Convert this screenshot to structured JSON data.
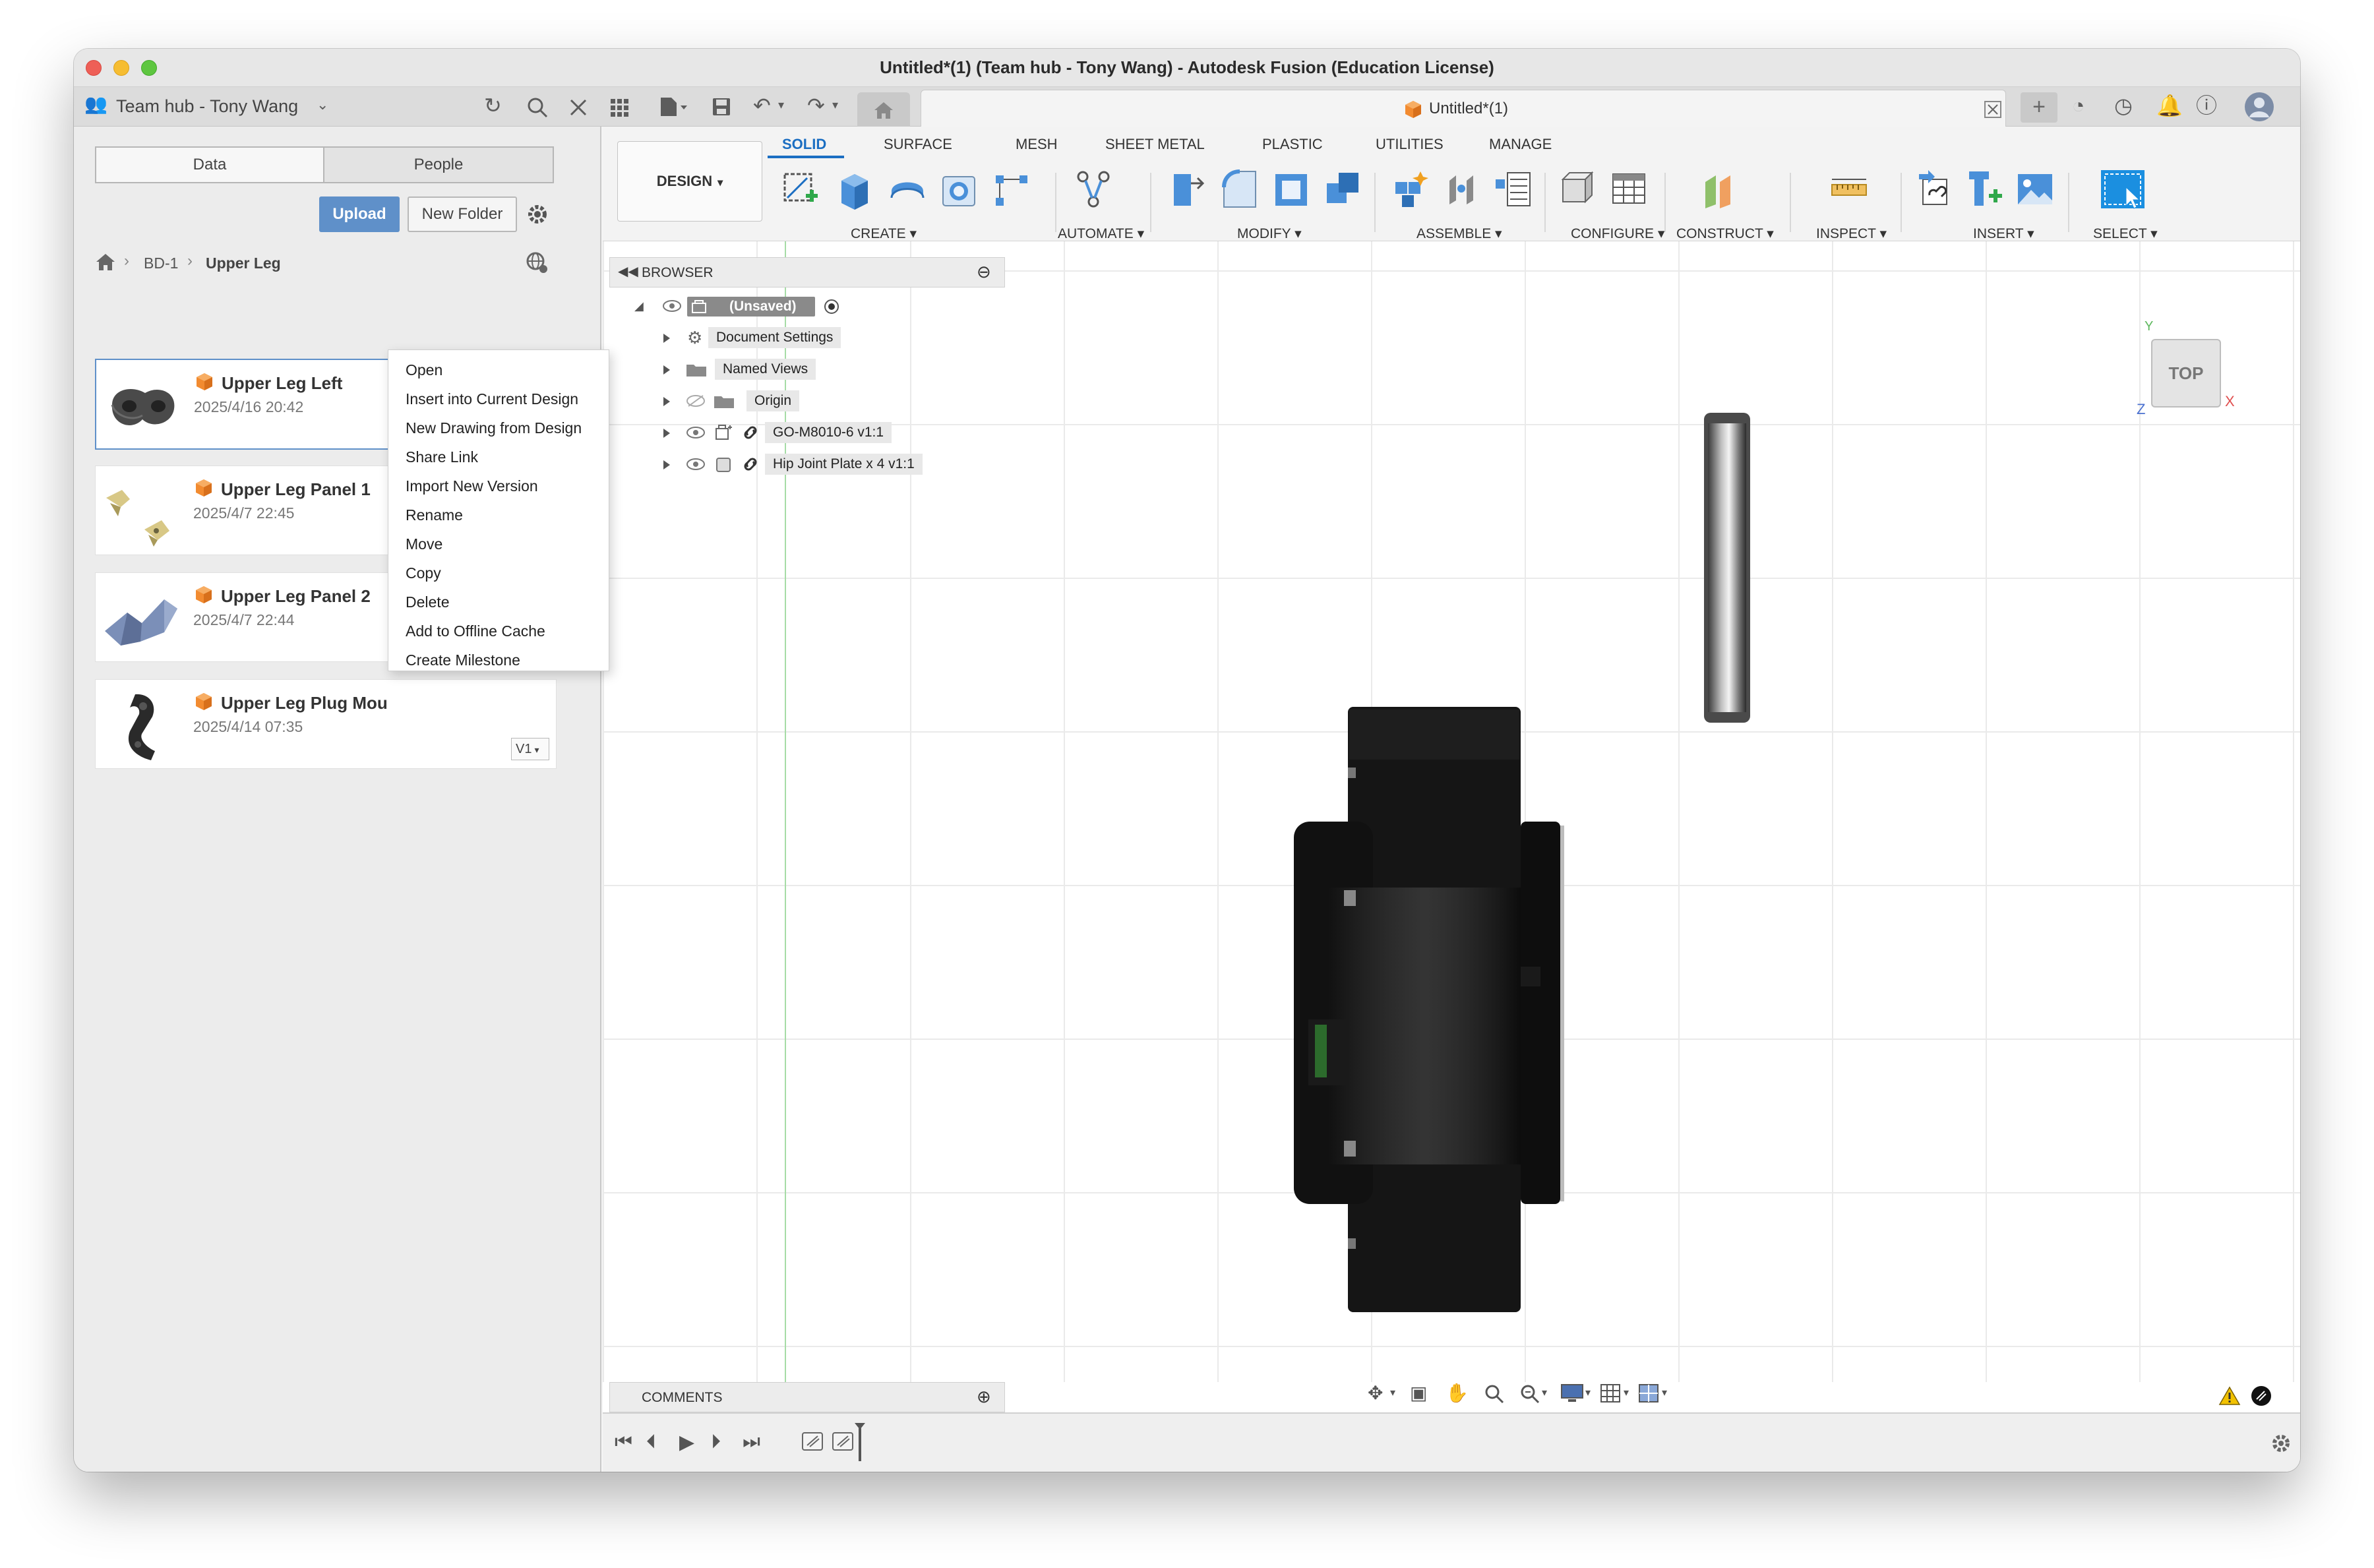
{
  "window": {
    "title": "Untitled*(1) (Team hub - Tony Wang) - Autodesk Fusion (Education License)"
  },
  "hub": {
    "name": "Team hub - Tony Wang"
  },
  "doc_tab": {
    "label": "Untitled*(1)"
  },
  "data_panel": {
    "tabs": [
      "Data",
      "People"
    ],
    "upload_label": "Upload",
    "new_folder_label": "New Folder",
    "breadcrumb": [
      "BD-1",
      "Upper Leg"
    ],
    "files": [
      {
        "name": "Upper Leg Left",
        "date": "2025/4/16 20:42"
      },
      {
        "name": "Upper Leg Panel 1",
        "date": "2025/4/7 22:45"
      },
      {
        "name": "Upper Leg Panel 2",
        "date": "2025/4/7 22:44"
      },
      {
        "name": "Upper Leg Plug Mou",
        "date": "2025/4/14 07:35",
        "version": "V1"
      }
    ]
  },
  "context_menu": {
    "items": [
      "Open",
      "Insert into Current Design",
      "New Drawing from Design",
      "Share Link",
      "Import New Version",
      "Rename",
      "Move",
      "Copy",
      "Delete",
      "Add to Offline Cache",
      "Create Milestone"
    ]
  },
  "toolbar": {
    "workspace_label": "DESIGN",
    "ribbon_tabs": [
      "SOLID",
      "SURFACE",
      "MESH",
      "SHEET METAL",
      "PLASTIC",
      "UTILITIES",
      "MANAGE"
    ],
    "active_tab": "SOLID",
    "groups": [
      "CREATE",
      "AUTOMATE",
      "MODIFY",
      "ASSEMBLE",
      "CONFIGURE",
      "CONSTRUCT",
      "INSPECT",
      "INSERT",
      "SELECT"
    ]
  },
  "browser": {
    "title": "BROWSER",
    "root": "(Unsaved)",
    "items": [
      "Document Settings",
      "Named Views",
      "Origin",
      "GO-M8010-6 v1:1",
      "Hip Joint Plate x 4 v1:1"
    ]
  },
  "comments": {
    "title": "COMMENTS"
  },
  "viewcube": {
    "face": "TOP",
    "axis_y": "Y",
    "axis_x": "X",
    "axis_z": "Z"
  },
  "colors": {
    "accent": "#1b6ec2",
    "upload_button": "#5f90c9",
    "selection_border": "#5f90c9"
  }
}
